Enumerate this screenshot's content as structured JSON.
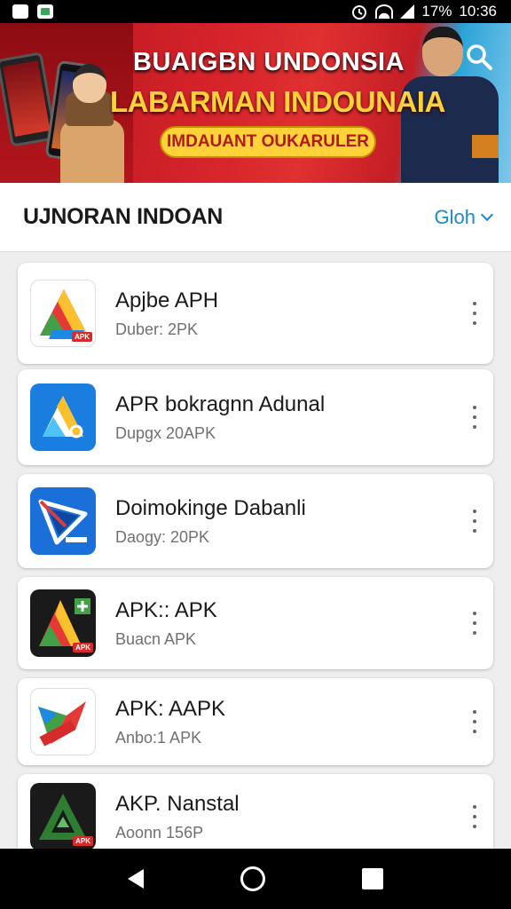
{
  "status_bar": {
    "battery": "17%",
    "time": "10:36"
  },
  "banner": {
    "title_line1": "BUAIGBN UNDONSIA",
    "title_line2": "LABARMAN INDOUNAIA",
    "pill_text": "IMDAUANT OUKARULER",
    "search_icon": "search-icon"
  },
  "section": {
    "title": "UJNORAN INDOAN",
    "filter_label": "Gloh"
  },
  "apps": [
    {
      "name": "Apjbe APH",
      "sub": "Duber: 2PK",
      "icon": "a1"
    },
    {
      "name": "APR bokragnn Adunal",
      "sub": "Dupgx 20APK",
      "icon": "a2"
    },
    {
      "name": "Doimokinge Dabanli",
      "sub": "Daogy: 20PK",
      "icon": "a3"
    },
    {
      "name": "APK:: APK",
      "sub": "Buacn APK",
      "icon": "a4"
    },
    {
      "name": "APK: AAPK",
      "sub": "Anbo:1 APK",
      "icon": "a5"
    },
    {
      "name": "AKP. Nanstal",
      "sub": "Aoonn 156P",
      "icon": "a6"
    }
  ],
  "icon_badges": {
    "a1": "APK",
    "a4": "APK",
    "a6": "APK"
  },
  "colors": {
    "accent": "#1e88c8",
    "banner_red": "#d4222a",
    "banner_yellow": "#ffd23a"
  }
}
